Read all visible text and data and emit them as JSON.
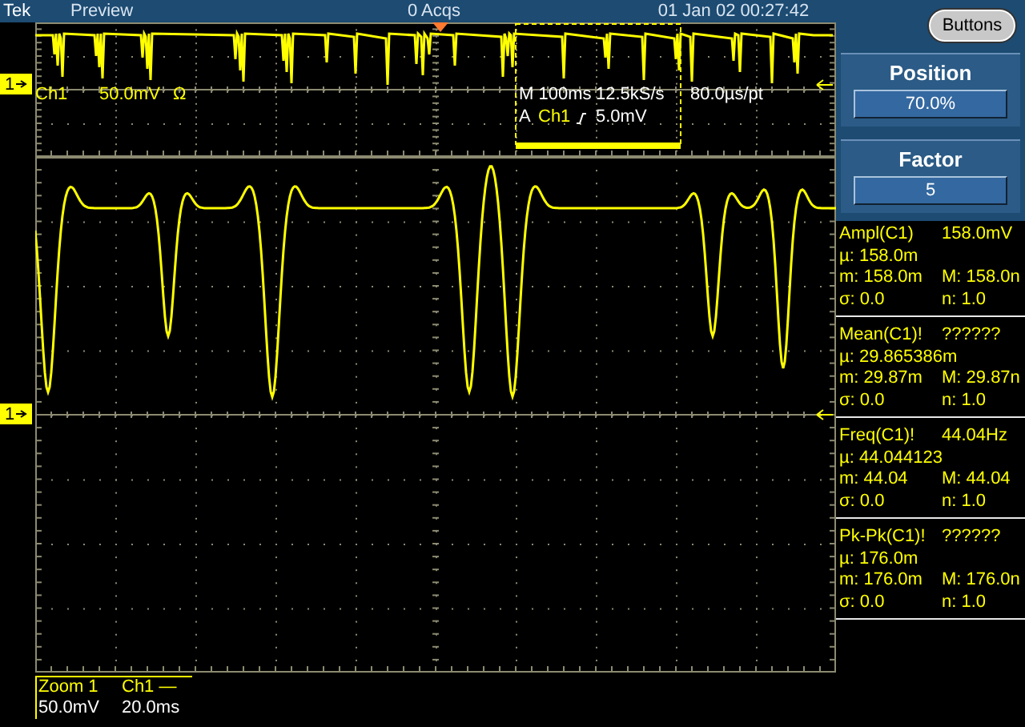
{
  "status_bar": {
    "brand": "Tek",
    "mode": "Preview",
    "acquisitions": "0 Acqs",
    "datetime": "01 Jan 02 00:27:42"
  },
  "toggle_button": "Buttons",
  "overview": {
    "marker": "1",
    "channel": "Ch1",
    "scale": "50.0mV",
    "termination": "Ω",
    "timebase": "M 100ms",
    "sample_rate": "12.5kS/s",
    "resolution": "80.0µs/pt",
    "trigger_label": "A",
    "trigger_source": "Ch1",
    "trigger_level": "5.0mV"
  },
  "main": {
    "marker": "1"
  },
  "controls": [
    {
      "label": "Position",
      "value": "70.0%"
    },
    {
      "label": "Factor",
      "value": "5"
    }
  ],
  "measurements": [
    {
      "name": "Ampl(C1)",
      "value": "158.0mV",
      "mean": "µ:  158.0m",
      "min": "m: 158.0m",
      "max": "M: 158.0n",
      "std": "σ: 0.0",
      "count": "n:  1.0"
    },
    {
      "name": "Mean(C1)!",
      "value": "??????",
      "mean": "µ:  29.865386m",
      "min": "m: 29.87m",
      "max": "M: 29.87n",
      "std": "σ: 0.0",
      "count": "n:  1.0"
    },
    {
      "name": "Freq(C1)!",
      "value": "44.04Hz",
      "mean": "µ:  44.044123",
      "min": "m: 44.04",
      "max": "M: 44.04",
      "std": "σ: 0.0",
      "count": "n:  1.0"
    },
    {
      "name": "Pk-Pk(C1)!",
      "value": "??????",
      "mean": "µ:  176.0m",
      "min": "m: 176.0m",
      "max": "M: 176.0n",
      "std": "σ: 0.0",
      "count": "n:  1.0"
    }
  ],
  "zoom_readout": {
    "title": "Zoom 1",
    "channel": "Ch1 —",
    "scale": "50.0mV",
    "timebase": "20.0ms"
  }
}
